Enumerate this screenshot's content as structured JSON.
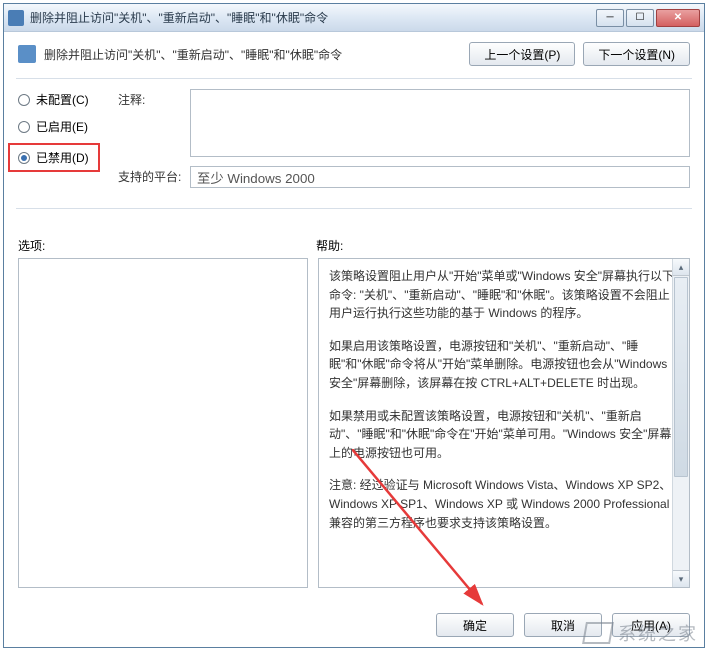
{
  "window": {
    "title": "删除并阻止访问\"关机\"、\"重新启动\"、\"睡眠\"和\"休眠\"命令"
  },
  "header": {
    "title": "删除并阻止访问\"关机\"、\"重新启动\"、\"睡眠\"和\"休眠\"命令",
    "prev_btn": "上一个设置(P)",
    "next_btn": "下一个设置(N)"
  },
  "radios": {
    "not_configured": "未配置(C)",
    "enabled": "已启用(E)",
    "disabled": "已禁用(D)"
  },
  "labels": {
    "comment": "注释:",
    "platform": "支持的平台:",
    "options": "选项:",
    "help": "帮助:"
  },
  "fields": {
    "comment_value": "",
    "platform_value": "至少 Windows 2000"
  },
  "help": {
    "p1": "该策略设置阻止用户从\"开始\"菜单或\"Windows 安全\"屏幕执行以下命令: \"关机\"、\"重新启动\"、\"睡眠\"和\"休眠\"。该策略设置不会阻止用户运行执行这些功能的基于 Windows 的程序。",
    "p2": "如果启用该策略设置，电源按钮和\"关机\"、\"重新启动\"、\"睡眠\"和\"休眠\"命令将从\"开始\"菜单删除。电源按钮也会从\"Windows 安全\"屏幕删除，该屏幕在按 CTRL+ALT+DELETE 时出现。",
    "p3": "如果禁用或未配置该策略设置，电源按钮和\"关机\"、\"重新启动\"、\"睡眠\"和\"休眠\"命令在\"开始\"菜单可用。\"Windows 安全\"屏幕上的电源按钮也可用。",
    "p4": "注意: 经过验证与 Microsoft Windows Vista、Windows XP SP2、Windows XP SP1、Windows XP 或 Windows 2000 Professional 兼容的第三方程序也要求支持该策略设置。"
  },
  "footer": {
    "ok": "确定",
    "cancel": "取消",
    "apply": "应用(A)"
  },
  "watermark": "系统之家"
}
